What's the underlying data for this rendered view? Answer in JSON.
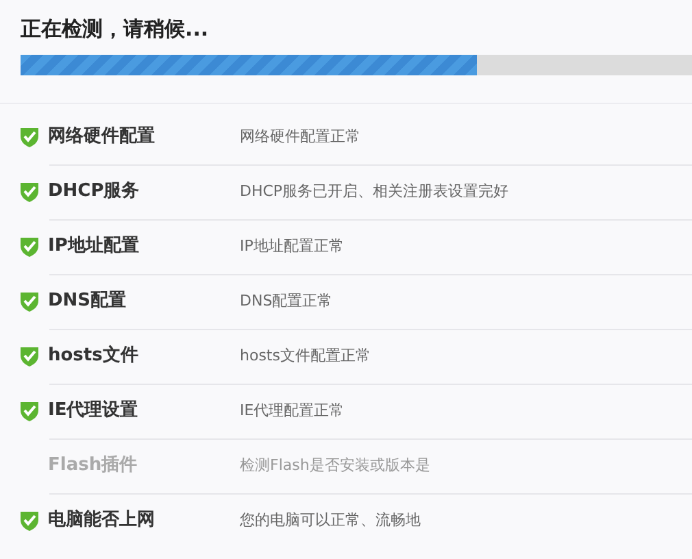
{
  "title": "正在检测，请稍候...",
  "progress": {
    "level": 0.68
  },
  "checks": [
    {
      "name": "网络硬件配置",
      "result": "网络硬件配置正常",
      "passed": true
    },
    {
      "name": "DHCP服务",
      "result": "DHCP服务已开启、相关注册表设置完好",
      "passed": true
    },
    {
      "name": "IP地址配置",
      "result": "IP地址配置正常",
      "passed": true
    },
    {
      "name": "DNS配置",
      "result": "DNS配置正常",
      "passed": true
    },
    {
      "name": "hosts文件",
      "result": "hosts文件配置正常",
      "passed": true
    },
    {
      "name": "IE代理设置",
      "result": "IE代理配置正常",
      "passed": true
    },
    {
      "name": "Flash插件",
      "result": "检测Flash是否安装或版本是",
      "passed": false
    },
    {
      "name": "电脑能否上网",
      "result": "您的电脑可以正常、流畅地",
      "passed": true
    }
  ]
}
